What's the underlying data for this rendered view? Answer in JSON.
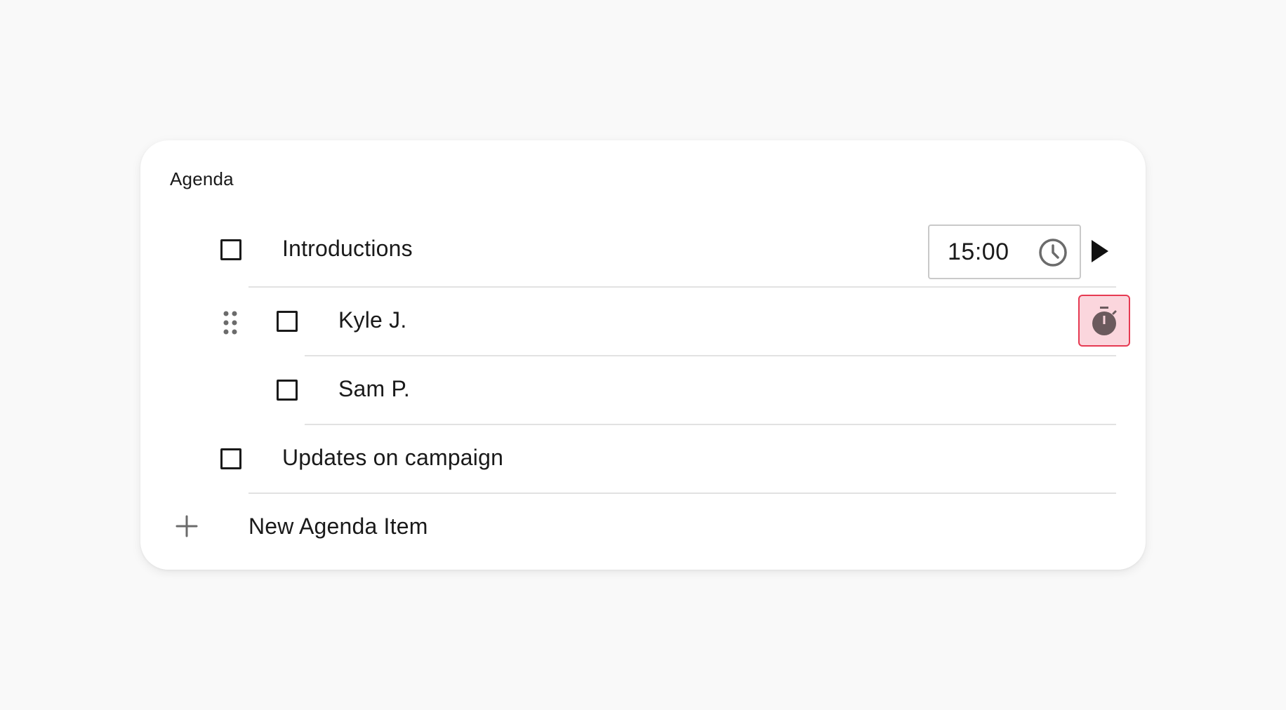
{
  "agenda": {
    "title": "Agenda",
    "items": [
      {
        "label": "Introductions",
        "checked": false,
        "duration": "15:00"
      },
      {
        "label": "Kyle J.",
        "checked": false
      },
      {
        "label": "Sam P.",
        "checked": false
      },
      {
        "label": "Updates on campaign",
        "checked": false
      }
    ],
    "new_item_label": "New Agenda Item"
  },
  "icons": {
    "clock": "clock-icon",
    "play": "play-icon",
    "drag": "drag-handle-icon",
    "timer": "stopwatch-icon",
    "add": "plus-icon"
  },
  "colors": {
    "background": "#f9f9f9",
    "card": "#ffffff",
    "timer_bg": "#fbd6dd",
    "timer_border": "#e63a52",
    "icon_gray": "#6b6b6b"
  }
}
